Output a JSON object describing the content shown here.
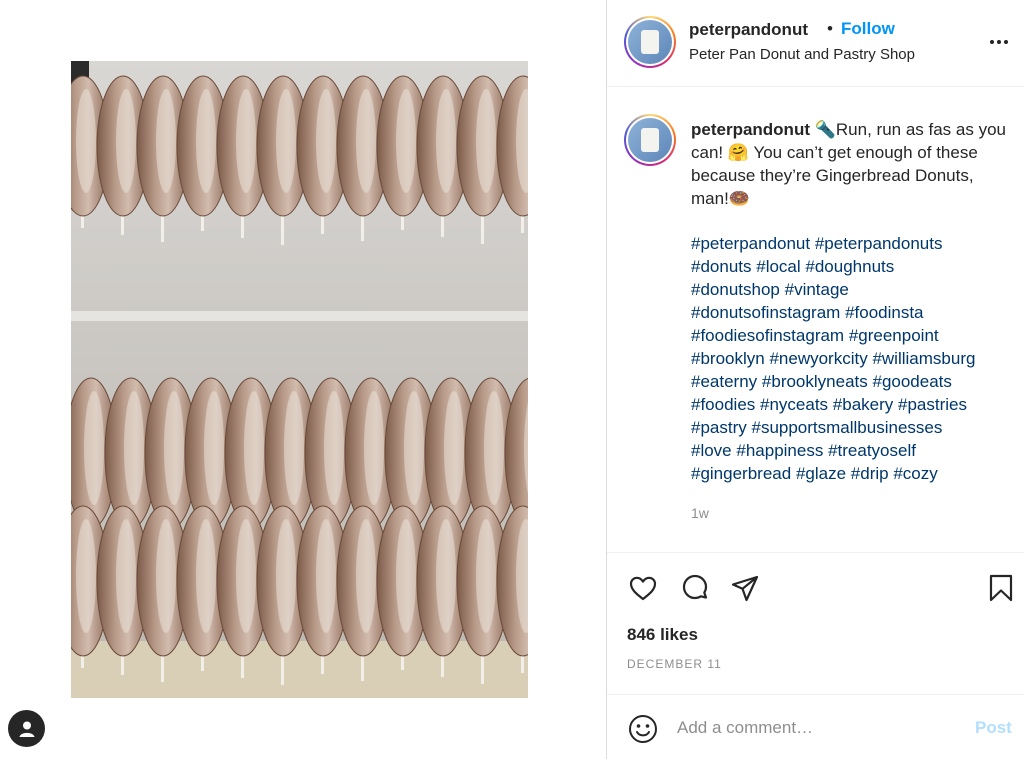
{
  "post": {
    "username": "peterpandonut",
    "separator": "•",
    "follow_label": "Follow",
    "display_name": "Peter Pan Donut and Pastry Shop",
    "more_icon": "more-horizontal-icon"
  },
  "caption": {
    "username": "peterpandonut",
    "text": "🔦Run, run as fas as you can! 🤗 You can’t get enough of these because they’re Gingerbread Donuts, man!🍩",
    "hashtag_lines": [
      [
        "#peterpandonut",
        "#peterpandonuts"
      ],
      [
        "#donuts",
        "#local",
        "#doughnuts"
      ],
      [
        "#donutshop",
        "#vintage"
      ],
      [
        "#donutsofinstagram",
        "#foodinsta"
      ],
      [
        "#foodiesofinstagram",
        "#greenpoint"
      ],
      [
        "#brooklyn",
        "#newyorkcity",
        "#williamsburg"
      ],
      [
        "#eaterny",
        "#brooklyneats",
        "#goodeats"
      ],
      [
        "#foodies",
        "#nyceats",
        "#bakery",
        "#pastries"
      ],
      [
        "#pastry",
        "#supportsmallbusinesses"
      ],
      [
        "#love",
        "#happiness",
        "#treatyoself"
      ],
      [
        "#gingerbread",
        "#glaze",
        "#drip",
        "#cozy"
      ]
    ],
    "time_ago": "1w"
  },
  "actions": {
    "icons": [
      "heart-icon",
      "comment-icon",
      "share-icon",
      "bookmark-icon"
    ]
  },
  "likes": "846 likes",
  "date": "DECEMBER 11",
  "comment": {
    "placeholder": "Add a comment…",
    "post_label": "Post",
    "emoji_icon": "smiley-icon"
  },
  "colors": {
    "link_blue": "#0095f6",
    "hashtag": "#00376b",
    "muted": "#8e8e8e",
    "post_disabled": "#b2dffc"
  }
}
